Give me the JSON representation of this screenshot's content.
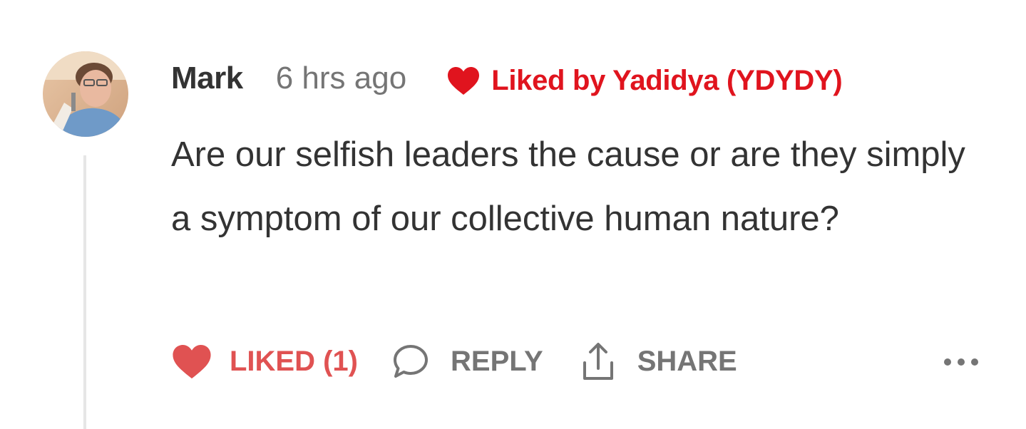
{
  "comment": {
    "author": "Mark",
    "timestamp": "6 hrs ago",
    "liked_by": "Liked by Yadidya (YDYDY)",
    "body": "Are our selfish leaders the cause or are they simply a symptom of our collective human nature?"
  },
  "actions": {
    "like_label": "LIKED (1)",
    "reply_label": "REPLY",
    "share_label": "SHARE"
  },
  "icons": {
    "avatar": "avatar-photo",
    "liked_by": "heart-icon",
    "like": "heart-icon",
    "reply": "speech-bubble-icon",
    "share": "share-upload-icon",
    "more": "more-horizontal-icon"
  },
  "colors": {
    "liked_by_red": "#e0141e",
    "liked_action_red": "#e05252",
    "text_primary": "#333333",
    "text_secondary": "#757575",
    "thread_line": "#e6e6e6"
  }
}
